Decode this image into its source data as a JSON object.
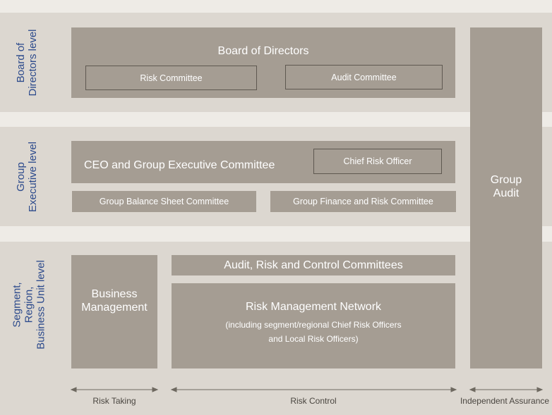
{
  "levels": {
    "board": [
      "Board of",
      "Directors level"
    ],
    "executive": [
      "Group",
      "Executive level"
    ],
    "segment": [
      "Segment,",
      "Region,",
      "Business Unit level"
    ]
  },
  "board": {
    "title": "Board of Directors",
    "risk_committee": "Risk Committee",
    "audit_committee": "Audit Committee"
  },
  "executive": {
    "ceo": "CEO and Group Executive Committee",
    "cro": "Chief Risk Officer",
    "balance_sheet": "Group Balance Sheet Committee",
    "finance_risk": "Group Finance and Risk Committee"
  },
  "group_audit": [
    "Group",
    "Audit"
  ],
  "segment": {
    "business_mgmt": [
      "Business",
      "Management"
    ],
    "arc": "Audit, Risk and Control Committees",
    "rmn_title": "Risk Management Network",
    "rmn_sub": [
      "(including segment/regional Chief Risk Officers",
      "and Local Risk Officers)"
    ]
  },
  "axis": {
    "risk_taking": "Risk Taking",
    "risk_control": "Risk Control",
    "independent": "Independent Assurance"
  }
}
